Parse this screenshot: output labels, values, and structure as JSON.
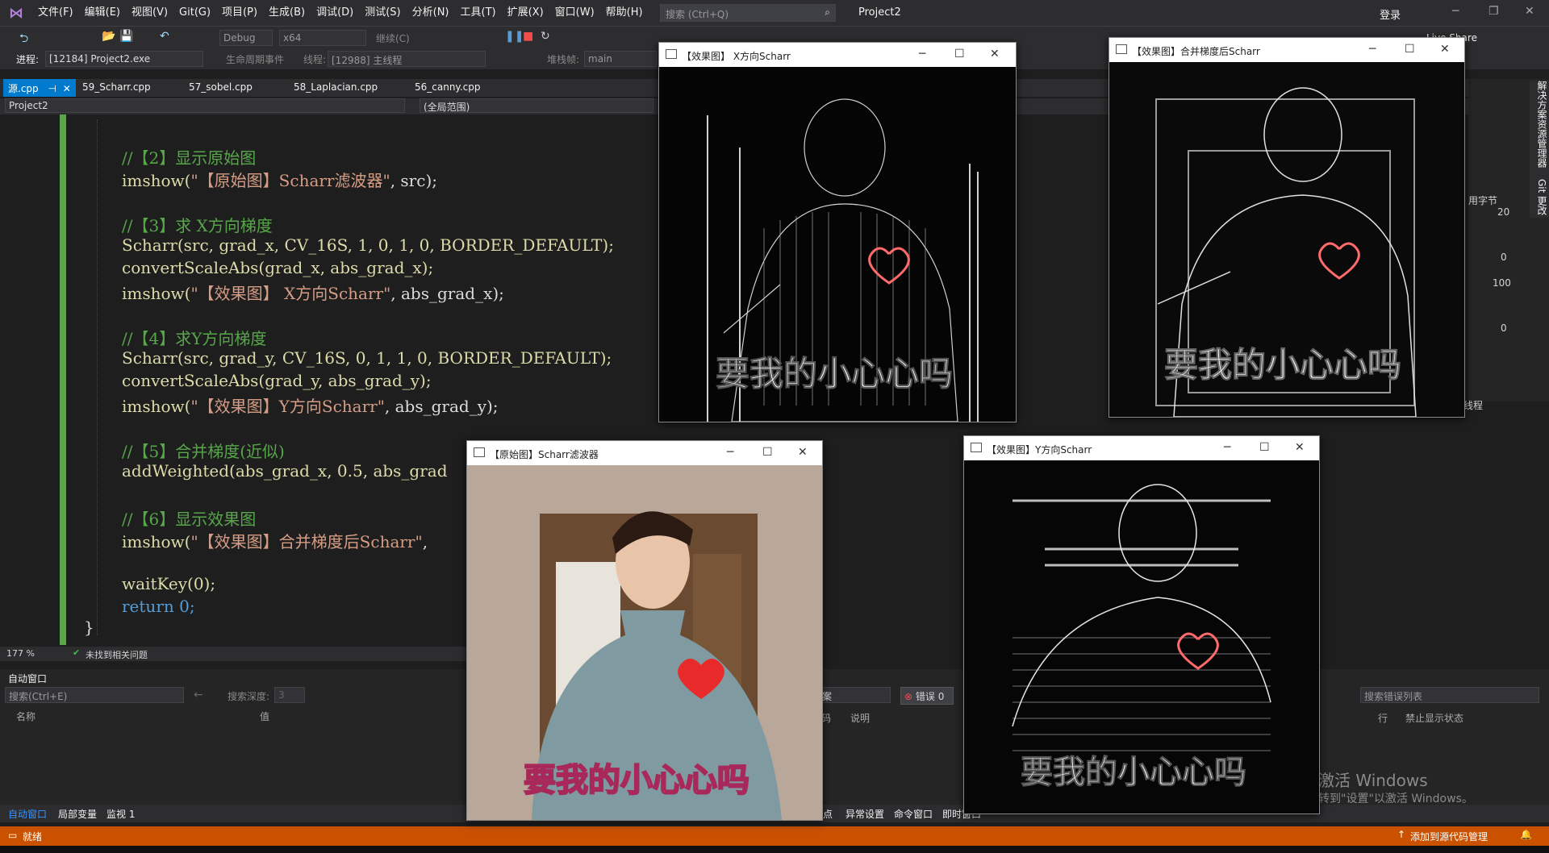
{
  "menu": {
    "items": [
      "文件(F)",
      "编辑(E)",
      "视图(V)",
      "Git(G)",
      "项目(P)",
      "生成(B)",
      "调试(D)",
      "测试(S)",
      "分析(N)",
      "工具(T)",
      "扩展(X)",
      "窗口(W)",
      "帮助(H)"
    ],
    "search_placeholder": "搜索 (Ctrl+Q)",
    "project": "Project2",
    "login": "登录"
  },
  "toolbar": {
    "config": "Debug",
    "platform": "x64",
    "continue": "继续(C)",
    "live_share": "Live Share"
  },
  "toolbar2": {
    "process_label": "进程:",
    "process_value": "[12184] Project2.exe",
    "lifecycle": "生命周期事件",
    "thread_label": "线程:",
    "thread_value": "[12988] 主线程",
    "stackframe_label": "堆栈帧:",
    "stackframe_value": "main"
  },
  "tabs": [
    "源.cpp",
    "59_Scharr.cpp",
    "57_sobel.cpp",
    "58_Laplacian.cpp",
    "56_canny.cpp"
  ],
  "nav": {
    "project": "Project2",
    "scope": "(全局范围)"
  },
  "code": {
    "l1": "//【2】显示原始图",
    "l2a": "imshow(",
    "l2b": "\"【原始图】Scharr滤波器\"",
    "l2c": ", src);",
    "l3": "//【3】求 X方向梯度",
    "l4": "Scharr(src, grad_x, CV_16S, 1, 0, 1, 0, BORDER_DEFAULT);",
    "l5": "convertScaleAbs(grad_x, abs_grad_x);",
    "l6a": "imshow(",
    "l6b": "\"【效果图】 X方向Scharr\"",
    "l6c": ", abs_grad_x);",
    "l7": "//【4】求Y方向梯度",
    "l8": "Scharr(src, grad_y, CV_16S, 0, 1, 1, 0, BORDER_DEFAULT);",
    "l9": "convertScaleAbs(grad_y, abs_grad_y);",
    "l10a": "imshow(",
    "l10b": "\"【效果图】Y方向Scharr\"",
    "l10c": ", abs_grad_y);",
    "l11": "//【5】合并梯度(近似)",
    "l12": "addWeighted(abs_grad_x, 0.5, abs_grad",
    "l13": "//【6】显示效果图",
    "l14a": "imshow(",
    "l14b": "\"【效果图】合并梯度后Scharr\"",
    "l14c": ", ",
    "l15": "waitKey(0);",
    "l16": "return 0;",
    "l17": "}"
  },
  "editor_status": {
    "zoom": "177 %",
    "issues": "未找到相关问题"
  },
  "auto_window": {
    "title": "自动窗口",
    "search_placeholder": "搜索(Ctrl+E)",
    "depth_label": "搜索深度:",
    "depth_value": "3",
    "col_name": "名称",
    "col_value": "值"
  },
  "error_list": {
    "errors": "错误 0",
    "search": "搜索错误列表",
    "col_desc": "说明",
    "col_line": "行",
    "col_suppress": "禁止显示状态",
    "code_frag": "码",
    "scope_frag": "案"
  },
  "bottom_tabs": [
    "自动窗口",
    "局部变量",
    "监视 1"
  ],
  "bottom_tabs_right": [
    "断点",
    "异常设置",
    "命令窗口",
    "即时窗口"
  ],
  "statusbar": {
    "ready": "就绪",
    "source_control": "添加到源代码管理"
  },
  "right_panel": {
    "sidetab1": "解决方案资源管理器",
    "sidetab2": "Git 更改",
    "bytes": "用字节",
    "v1": "20",
    "v2": "0",
    "v3": "100",
    "v4": "0",
    "thread": "线程"
  },
  "windows": {
    "x_title": "【效果图】 X方向Scharr",
    "merged_title": "【效果图】合并梯度后Scharr",
    "src_title": "【原始图】Scharr滤波器",
    "y_title": "【效果图】Y方向Scharr",
    "caption": "要我的小心心吗"
  },
  "activation": {
    "line1": "激活 Windows",
    "line2": "转到\"设置\"以激活 Windows。"
  }
}
